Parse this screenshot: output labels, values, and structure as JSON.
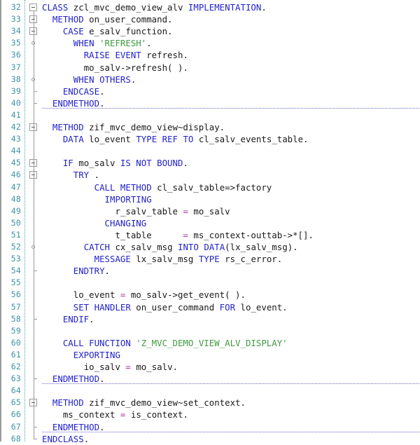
{
  "editor": {
    "name": "abap-code-editor",
    "language": "ABAP",
    "first_line_number": 32,
    "last_line_number": 68,
    "colors": {
      "background": "#ffffff",
      "keyword": "#2222cc",
      "identifier": "#1a1a1a",
      "string": "#3f9a3f",
      "operator": "#a0399a",
      "line_number": "#3f93a4",
      "fold_line": "#9a9a9a",
      "separator": "#6a6ad0"
    }
  },
  "lines": [
    {
      "number": "32",
      "fold": "box",
      "text": "CLASS zcl_mvc_demo_view_alv IMPLEMENTATION.",
      "tokens": [
        {
          "t": "CLASS",
          "c": "kw"
        },
        {
          "t": " ",
          "c": "pun"
        },
        {
          "t": "zcl_mvc_demo_view_alv",
          "c": "id"
        },
        {
          "t": " ",
          "c": "pun"
        },
        {
          "t": "IMPLEMENTATION",
          "c": "kw"
        },
        {
          "t": ".",
          "c": "pun"
        }
      ]
    },
    {
      "number": "33",
      "fold": "box",
      "text": "  METHOD on_user_command.",
      "tokens": [
        {
          "t": "  ",
          "c": "pun"
        },
        {
          "t": "METHOD",
          "c": "kw"
        },
        {
          "t": " ",
          "c": "pun"
        },
        {
          "t": "on_user_command",
          "c": "id"
        },
        {
          "t": ".",
          "c": "pun"
        }
      ]
    },
    {
      "number": "34",
      "fold": "box",
      "text": "    CASE e_salv_function.",
      "tokens": [
        {
          "t": "    ",
          "c": "pun"
        },
        {
          "t": "CASE",
          "c": "kw"
        },
        {
          "t": " ",
          "c": "pun"
        },
        {
          "t": "e_salv_function",
          "c": "id"
        },
        {
          "t": ".",
          "c": "pun"
        }
      ]
    },
    {
      "number": "35",
      "fold": "dot",
      "text": "      WHEN 'REFRESH'.",
      "tokens": [
        {
          "t": "      ",
          "c": "pun"
        },
        {
          "t": "WHEN",
          "c": "kw"
        },
        {
          "t": " ",
          "c": "pun"
        },
        {
          "t": "'REFRESH'",
          "c": "str"
        },
        {
          "t": ".",
          "c": "pun"
        }
      ]
    },
    {
      "number": "36",
      "fold": "none",
      "text": "        RAISE EVENT refresh.",
      "tokens": [
        {
          "t": "        ",
          "c": "pun"
        },
        {
          "t": "RAISE EVENT",
          "c": "kw"
        },
        {
          "t": " ",
          "c": "pun"
        },
        {
          "t": "refresh",
          "c": "id"
        },
        {
          "t": ".",
          "c": "pun"
        }
      ]
    },
    {
      "number": "37",
      "fold": "none",
      "text": "        mo_salv->refresh( ).",
      "tokens": [
        {
          "t": "        ",
          "c": "pun"
        },
        {
          "t": "mo_salv->refresh( )",
          "c": "id"
        },
        {
          "t": ".",
          "c": "pun"
        }
      ]
    },
    {
      "number": "38",
      "fold": "dot",
      "text": "      WHEN OTHERS.",
      "tokens": [
        {
          "t": "      ",
          "c": "pun"
        },
        {
          "t": "WHEN OTHERS",
          "c": "kw"
        },
        {
          "t": ".",
          "c": "pun"
        }
      ]
    },
    {
      "number": "39",
      "fold": "tick",
      "text": "    ENDCASE.",
      "tokens": [
        {
          "t": "    ",
          "c": "pun"
        },
        {
          "t": "ENDCASE",
          "c": "kw"
        },
        {
          "t": ".",
          "c": "pun"
        }
      ]
    },
    {
      "number": "40",
      "fold": "tick",
      "separator_below": true,
      "text": "  ENDMETHOD.",
      "tokens": [
        {
          "t": "  ",
          "c": "pun"
        },
        {
          "t": "ENDMETHOD",
          "c": "kw"
        },
        {
          "t": ".",
          "c": "pun"
        }
      ]
    },
    {
      "number": "41",
      "fold": "none",
      "text": "",
      "tokens": []
    },
    {
      "number": "42",
      "fold": "box",
      "text": "  METHOD zif_mvc_demo_view~display.",
      "tokens": [
        {
          "t": "  ",
          "c": "pun"
        },
        {
          "t": "METHOD",
          "c": "kw"
        },
        {
          "t": " ",
          "c": "pun"
        },
        {
          "t": "zif_mvc_demo_view~display",
          "c": "id"
        },
        {
          "t": ".",
          "c": "pun"
        }
      ]
    },
    {
      "number": "43",
      "fold": "none",
      "text": "    DATA lo_event TYPE REF TO cl_salv_events_table.",
      "tokens": [
        {
          "t": "    ",
          "c": "pun"
        },
        {
          "t": "DATA",
          "c": "kw"
        },
        {
          "t": " ",
          "c": "pun"
        },
        {
          "t": "lo_event",
          "c": "id"
        },
        {
          "t": " ",
          "c": "pun"
        },
        {
          "t": "TYPE REF TO",
          "c": "kw"
        },
        {
          "t": " ",
          "c": "pun"
        },
        {
          "t": "cl_salv_events_table",
          "c": "id"
        },
        {
          "t": ".",
          "c": "pun"
        }
      ]
    },
    {
      "number": "44",
      "fold": "none",
      "text": "",
      "tokens": []
    },
    {
      "number": "45",
      "fold": "box",
      "text": "    IF mo_salv IS NOT BOUND.",
      "tokens": [
        {
          "t": "    ",
          "c": "pun"
        },
        {
          "t": "IF",
          "c": "kw"
        },
        {
          "t": " ",
          "c": "pun"
        },
        {
          "t": "mo_salv",
          "c": "id"
        },
        {
          "t": " ",
          "c": "pun"
        },
        {
          "t": "IS NOT BOUND",
          "c": "kw"
        },
        {
          "t": ".",
          "c": "pun"
        }
      ]
    },
    {
      "number": "46",
      "fold": "box",
      "text": "      TRY .",
      "tokens": [
        {
          "t": "      ",
          "c": "pun"
        },
        {
          "t": "TRY",
          "c": "kw"
        },
        {
          "t": " .",
          "c": "pun"
        }
      ]
    },
    {
      "number": "47",
      "fold": "none",
      "text": "          CALL METHOD cl_salv_table=>factory",
      "tokens": [
        {
          "t": "          ",
          "c": "pun"
        },
        {
          "t": "CALL METHOD",
          "c": "kw"
        },
        {
          "t": " ",
          "c": "pun"
        },
        {
          "t": "cl_salv_table=>factory",
          "c": "id"
        }
      ]
    },
    {
      "number": "48",
      "fold": "none",
      "text": "            IMPORTING",
      "tokens": [
        {
          "t": "            ",
          "c": "pun"
        },
        {
          "t": "IMPORTING",
          "c": "kw"
        }
      ]
    },
    {
      "number": "49",
      "fold": "none",
      "text": "              r_salv_table = mo_salv",
      "tokens": [
        {
          "t": "              ",
          "c": "pun"
        },
        {
          "t": "r_salv_table",
          "c": "id"
        },
        {
          "t": " ",
          "c": "pun"
        },
        {
          "t": "=",
          "c": "op"
        },
        {
          "t": " ",
          "c": "pun"
        },
        {
          "t": "mo_salv",
          "c": "id"
        }
      ]
    },
    {
      "number": "50",
      "fold": "none",
      "text": "            CHANGING",
      "tokens": [
        {
          "t": "            ",
          "c": "pun"
        },
        {
          "t": "CHANGING",
          "c": "kw"
        }
      ]
    },
    {
      "number": "51",
      "fold": "none",
      "text": "              t_table      = ms_context-outtab->*[].",
      "tokens": [
        {
          "t": "              ",
          "c": "pun"
        },
        {
          "t": "t_table",
          "c": "id"
        },
        {
          "t": "      ",
          "c": "pun"
        },
        {
          "t": "=",
          "c": "op"
        },
        {
          "t": " ",
          "c": "pun"
        },
        {
          "t": "ms_context-outtab->*[]",
          "c": "id"
        },
        {
          "t": ".",
          "c": "pun"
        }
      ]
    },
    {
      "number": "52",
      "fold": "dot",
      "text": "        CATCH cx_salv_msg INTO DATA(lx_salv_msg).",
      "tokens": [
        {
          "t": "        ",
          "c": "pun"
        },
        {
          "t": "CATCH",
          "c": "kw"
        },
        {
          "t": " ",
          "c": "pun"
        },
        {
          "t": "cx_salv_msg",
          "c": "id"
        },
        {
          "t": " ",
          "c": "pun"
        },
        {
          "t": "INTO",
          "c": "kw"
        },
        {
          "t": " ",
          "c": "pun"
        },
        {
          "t": "DATA",
          "c": "kw"
        },
        {
          "t": "(",
          "c": "pun"
        },
        {
          "t": "lx_salv_msg",
          "c": "id"
        },
        {
          "t": ").",
          "c": "pun"
        }
      ]
    },
    {
      "number": "53",
      "fold": "none",
      "text": "          MESSAGE lx_salv_msg TYPE rs_c_error.",
      "tokens": [
        {
          "t": "          ",
          "c": "pun"
        },
        {
          "t": "MESSAGE",
          "c": "kw"
        },
        {
          "t": " ",
          "c": "pun"
        },
        {
          "t": "lx_salv_msg",
          "c": "id"
        },
        {
          "t": " ",
          "c": "pun"
        },
        {
          "t": "TYPE",
          "c": "kw"
        },
        {
          "t": " ",
          "c": "pun"
        },
        {
          "t": "rs_c_error",
          "c": "id"
        },
        {
          "t": ".",
          "c": "pun"
        }
      ]
    },
    {
      "number": "54",
      "fold": "tick",
      "text": "      ENDTRY.",
      "tokens": [
        {
          "t": "      ",
          "c": "pun"
        },
        {
          "t": "ENDTRY",
          "c": "kw"
        },
        {
          "t": ".",
          "c": "pun"
        }
      ]
    },
    {
      "number": "55",
      "fold": "none",
      "text": "",
      "tokens": []
    },
    {
      "number": "56",
      "fold": "none",
      "text": "      lo_event = mo_salv->get_event( ).",
      "tokens": [
        {
          "t": "      ",
          "c": "pun"
        },
        {
          "t": "lo_event",
          "c": "id"
        },
        {
          "t": " ",
          "c": "pun"
        },
        {
          "t": "=",
          "c": "op"
        },
        {
          "t": " ",
          "c": "pun"
        },
        {
          "t": "mo_salv->get_event( )",
          "c": "id"
        },
        {
          "t": ".",
          "c": "pun"
        }
      ]
    },
    {
      "number": "57",
      "fold": "none",
      "text": "      SET HANDLER on_user_command FOR lo_event.",
      "tokens": [
        {
          "t": "      ",
          "c": "pun"
        },
        {
          "t": "SET HANDLER",
          "c": "kw"
        },
        {
          "t": " ",
          "c": "pun"
        },
        {
          "t": "on_user_command",
          "c": "id"
        },
        {
          "t": " ",
          "c": "pun"
        },
        {
          "t": "FOR",
          "c": "kw"
        },
        {
          "t": " ",
          "c": "pun"
        },
        {
          "t": "lo_event",
          "c": "id"
        },
        {
          "t": ".",
          "c": "pun"
        }
      ]
    },
    {
      "number": "58",
      "fold": "tick",
      "text": "    ENDIF.",
      "tokens": [
        {
          "t": "    ",
          "c": "pun"
        },
        {
          "t": "ENDIF",
          "c": "kw"
        },
        {
          "t": ".",
          "c": "pun"
        }
      ]
    },
    {
      "number": "59",
      "fold": "none",
      "text": "",
      "tokens": []
    },
    {
      "number": "60",
      "fold": "none",
      "text": "    CALL FUNCTION 'Z_MVC_DEMO_VIEW_ALV_DISPLAY'",
      "tokens": [
        {
          "t": "    ",
          "c": "pun"
        },
        {
          "t": "CALL FUNCTION",
          "c": "kw"
        },
        {
          "t": " ",
          "c": "pun"
        },
        {
          "t": "'Z_MVC_DEMO_VIEW_ALV_DISPLAY'",
          "c": "str"
        }
      ]
    },
    {
      "number": "61",
      "fold": "none",
      "text": "      EXPORTING",
      "tokens": [
        {
          "t": "      ",
          "c": "pun"
        },
        {
          "t": "EXPORTING",
          "c": "kw"
        }
      ]
    },
    {
      "number": "62",
      "fold": "none",
      "text": "        io_salv = mo_salv.",
      "tokens": [
        {
          "t": "        ",
          "c": "pun"
        },
        {
          "t": "io_salv",
          "c": "id"
        },
        {
          "t": " ",
          "c": "pun"
        },
        {
          "t": "=",
          "c": "op"
        },
        {
          "t": " ",
          "c": "pun"
        },
        {
          "t": "mo_salv",
          "c": "id"
        },
        {
          "t": ".",
          "c": "pun"
        }
      ]
    },
    {
      "number": "63",
      "fold": "tick",
      "separator_below": true,
      "text": "  ENDMETHOD.",
      "tokens": [
        {
          "t": "  ",
          "c": "pun"
        },
        {
          "t": "ENDMETHOD",
          "c": "kw"
        },
        {
          "t": ".",
          "c": "pun"
        }
      ]
    },
    {
      "number": "64",
      "fold": "none",
      "text": "",
      "tokens": []
    },
    {
      "number": "65",
      "fold": "box",
      "text": "  METHOD zif_mvc_demo_view~set_context.",
      "tokens": [
        {
          "t": "  ",
          "c": "pun"
        },
        {
          "t": "METHOD",
          "c": "kw"
        },
        {
          "t": " ",
          "c": "pun"
        },
        {
          "t": "zif_mvc_demo_view~set_context",
          "c": "id"
        },
        {
          "t": ".",
          "c": "pun"
        }
      ]
    },
    {
      "number": "66",
      "fold": "none",
      "text": "    ms_context = is_context.",
      "tokens": [
        {
          "t": "    ",
          "c": "pun"
        },
        {
          "t": "ms_context",
          "c": "id"
        },
        {
          "t": " ",
          "c": "pun"
        },
        {
          "t": "=",
          "c": "op"
        },
        {
          "t": " ",
          "c": "pun"
        },
        {
          "t": "is_context",
          "c": "id"
        },
        {
          "t": ".",
          "c": "pun"
        }
      ]
    },
    {
      "number": "67",
      "fold": "tick",
      "separator_below": true,
      "text": "  ENDMETHOD.",
      "tokens": [
        {
          "t": "  ",
          "c": "pun"
        },
        {
          "t": "ENDMETHOD",
          "c": "kw"
        },
        {
          "t": ".",
          "c": "pun"
        }
      ]
    },
    {
      "number": "68",
      "fold": "corner",
      "text": "ENDCLASS.",
      "tokens": [
        {
          "t": "ENDCLASS",
          "c": "kw"
        },
        {
          "t": ".",
          "c": "pun"
        }
      ]
    }
  ]
}
